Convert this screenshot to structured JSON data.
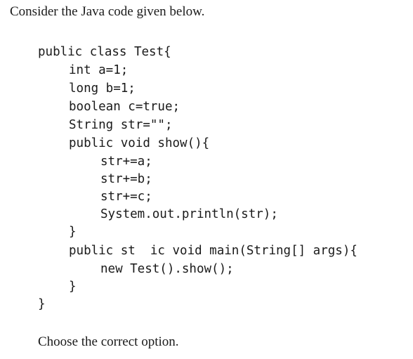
{
  "intro": "Consider the Java code given below.",
  "code_lines": [
    {
      "indent": 0,
      "text": "public class Test{"
    },
    {
      "indent": 1,
      "text": "int a=1;"
    },
    {
      "indent": 1,
      "text": "long b=1;"
    },
    {
      "indent": 1,
      "text": "boolean c=true;"
    },
    {
      "indent": 1,
      "text": "String str=\"\";"
    },
    {
      "indent": 1,
      "text": "public void show(){"
    },
    {
      "indent": 2,
      "text": "str+=a;"
    },
    {
      "indent": 2,
      "text": "str+=b;"
    },
    {
      "indent": 2,
      "text": "str+=c;"
    },
    {
      "indent": 2,
      "text": "System.out.println(str);"
    },
    {
      "indent": 1,
      "text": "}"
    },
    {
      "indent": 1,
      "text": "public st  ic void main(String[] args){"
    },
    {
      "indent": 2,
      "text": "new Test().show();"
    },
    {
      "indent": 1,
      "text": "}"
    },
    {
      "indent": 0,
      "text": "}"
    }
  ],
  "outro": "Choose the correct option."
}
